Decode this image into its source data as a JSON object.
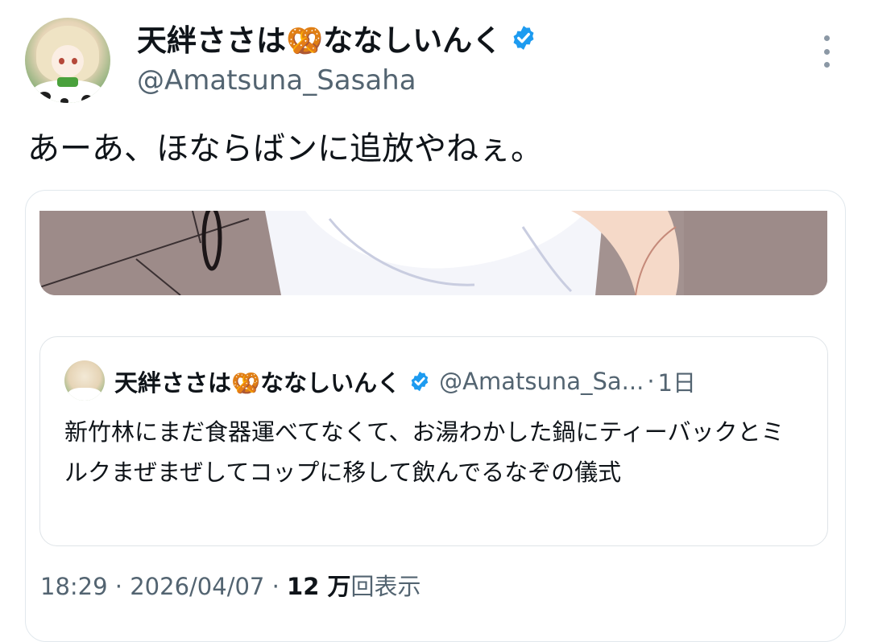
{
  "author": {
    "display_name": "天絆ささは🥨ななしいんく",
    "handle": "@Amatsuna_Sasaha"
  },
  "tweet": {
    "text": "あーあ、ほならばンに追放やねぇ。"
  },
  "quoted_tweet": {
    "display_name": "天絆ささは🥨ななしいんく",
    "handle": "@Amatsuna_Sa...",
    "separator": "·",
    "time": "1日",
    "text": "新竹林にまだ食器運べてなくて、お湯わかした鍋にティーバックとミルクまぜまぜしてコップに移して飲んでるなぞの儀式"
  },
  "meta": {
    "time": "18:29",
    "sep1": " · ",
    "date": "2026/04/07",
    "sep2": " · ",
    "views_count": "12 万",
    "views_label": "回表示"
  },
  "colors": {
    "verified": "#1d9bf0",
    "secondary_text": "#536471",
    "primary_text": "#0f1419"
  }
}
